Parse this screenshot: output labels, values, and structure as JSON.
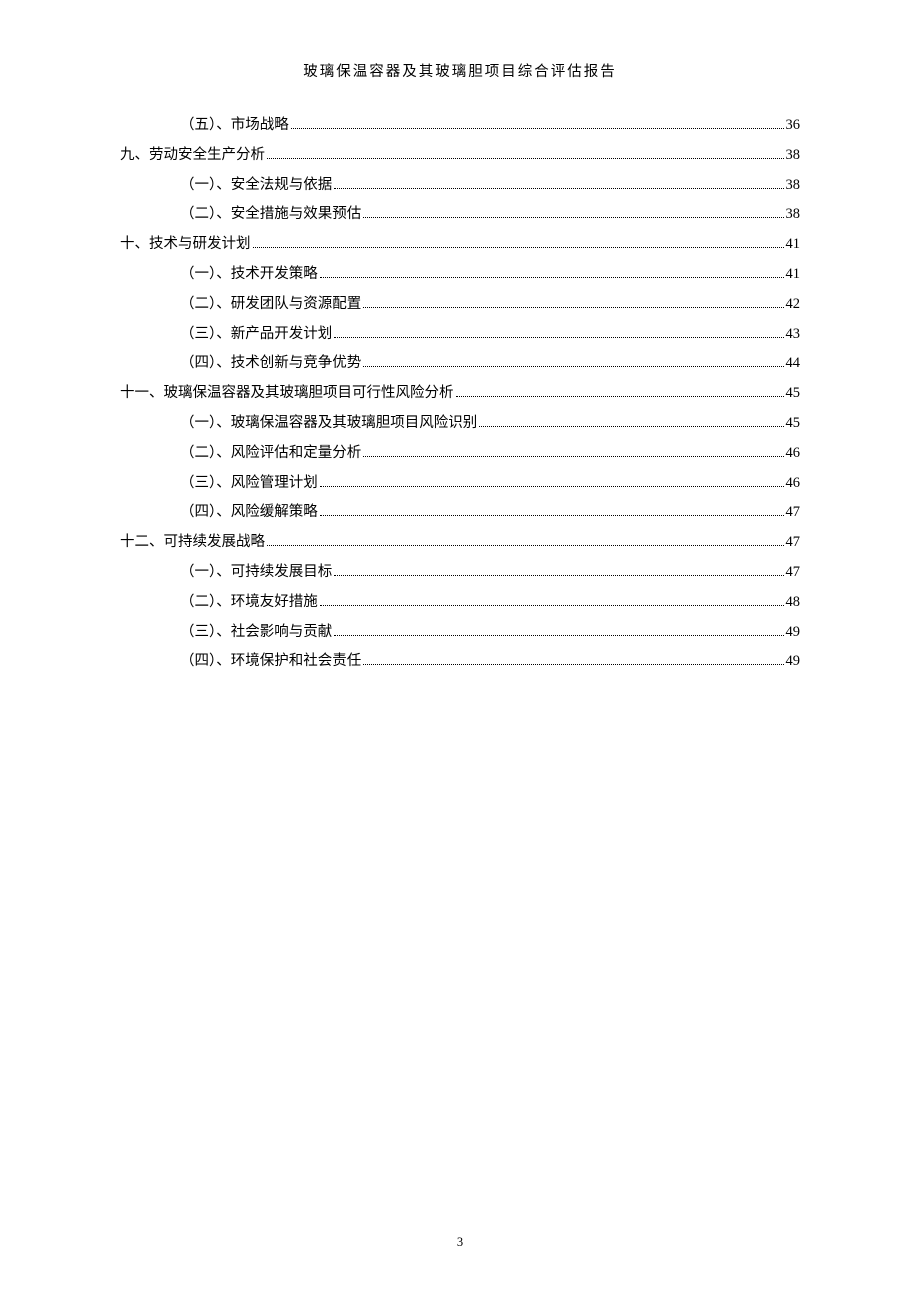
{
  "header_title": "玻璃保温容器及其玻璃胆项目综合评估报告",
  "page_number": "3",
  "toc": [
    {
      "level": 2,
      "label": "（五）、市场战略",
      "page": "36"
    },
    {
      "level": 1,
      "label": "九、劳动安全生产分析",
      "page": "38"
    },
    {
      "level": 2,
      "label": "（一）、安全法规与依据",
      "page": "38"
    },
    {
      "level": 2,
      "label": "（二）、安全措施与效果预估",
      "page": "38"
    },
    {
      "level": 1,
      "label": "十、技术与研发计划",
      "page": "41"
    },
    {
      "level": 2,
      "label": "（一）、技术开发策略",
      "page": "41"
    },
    {
      "level": 2,
      "label": "（二）、研发团队与资源配置",
      "page": "42"
    },
    {
      "level": 2,
      "label": "（三）、新产品开发计划",
      "page": "43"
    },
    {
      "level": 2,
      "label": "（四）、技术创新与竞争优势",
      "page": "44"
    },
    {
      "level": 1,
      "label": "十一、玻璃保温容器及其玻璃胆项目可行性风险分析",
      "page": "45"
    },
    {
      "level": 2,
      "label": "（一）、玻璃保温容器及其玻璃胆项目风险识别",
      "page": "45"
    },
    {
      "level": 2,
      "label": "（二）、风险评估和定量分析",
      "page": "46"
    },
    {
      "level": 2,
      "label": "（三）、风险管理计划",
      "page": "46"
    },
    {
      "level": 2,
      "label": "（四）、风险缓解策略",
      "page": "47"
    },
    {
      "level": 1,
      "label": "十二、可持续发展战略",
      "page": "47"
    },
    {
      "level": 2,
      "label": "（一）、可持续发展目标",
      "page": "47"
    },
    {
      "level": 2,
      "label": "（二）、环境友好措施",
      "page": "48"
    },
    {
      "level": 2,
      "label": "（三）、社会影响与贡献",
      "page": "49"
    },
    {
      "level": 2,
      "label": "（四）、环境保护和社会责任",
      "page": "49"
    }
  ]
}
